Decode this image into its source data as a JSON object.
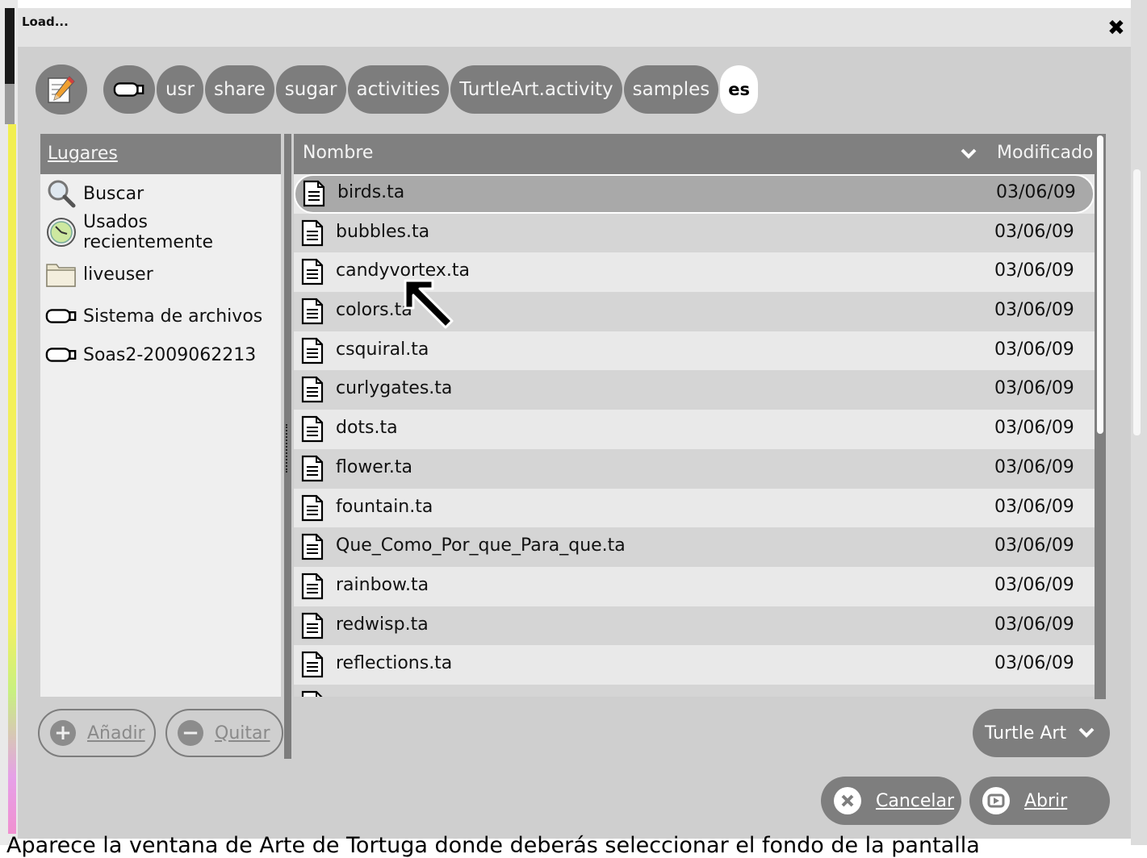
{
  "dialog": {
    "title": "Load...",
    "close_glyph": "✖"
  },
  "breadcrumb": {
    "items": [
      "usr",
      "share",
      "sugar",
      "activities",
      "TurtleArt.activity",
      "samples",
      "es"
    ],
    "active": "es"
  },
  "places": {
    "header": "Lugares",
    "items": [
      {
        "label": "Buscar",
        "icon": "search-icon"
      },
      {
        "label": "Usados recientemente",
        "icon": "recent-clock-icon"
      },
      {
        "label": "liveuser",
        "icon": "folder-icon"
      },
      {
        "label": "Sistema de archivos",
        "icon": "drive-icon"
      },
      {
        "label": "Soas2-2009062213",
        "icon": "drive-icon"
      }
    ],
    "add_label": "Añadir",
    "remove_label": "Quitar"
  },
  "files": {
    "col_name": "Nombre",
    "col_modified": "Modificado",
    "rows": [
      {
        "name": "birds.ta",
        "date": "03/06/09"
      },
      {
        "name": "bubbles.ta",
        "date": "03/06/09"
      },
      {
        "name": "candyvortex.ta",
        "date": "03/06/09"
      },
      {
        "name": "colors.ta",
        "date": "03/06/09"
      },
      {
        "name": "csquiral.ta",
        "date": "03/06/09"
      },
      {
        "name": "curlygates.ta",
        "date": "03/06/09"
      },
      {
        "name": "dots.ta",
        "date": "03/06/09"
      },
      {
        "name": "flower.ta",
        "date": "03/06/09"
      },
      {
        "name": "fountain.ta",
        "date": "03/06/09"
      },
      {
        "name": "Que_Como_Por_que_Para_que.ta",
        "date": "03/06/09"
      },
      {
        "name": "rainbow.ta",
        "date": "03/06/09"
      },
      {
        "name": "redwisp.ta",
        "date": "03/06/09"
      },
      {
        "name": "reflections.ta",
        "date": "03/06/09"
      }
    ],
    "selected": "birds.ta"
  },
  "filter": {
    "selected": "Turtle Art"
  },
  "actions": {
    "cancel_label": "Cancelar",
    "open_label": "Abrir"
  },
  "caption": "Aparece la ventana de Arte de Tortuga donde deberás seleccionar el fondo de la pantalla"
}
